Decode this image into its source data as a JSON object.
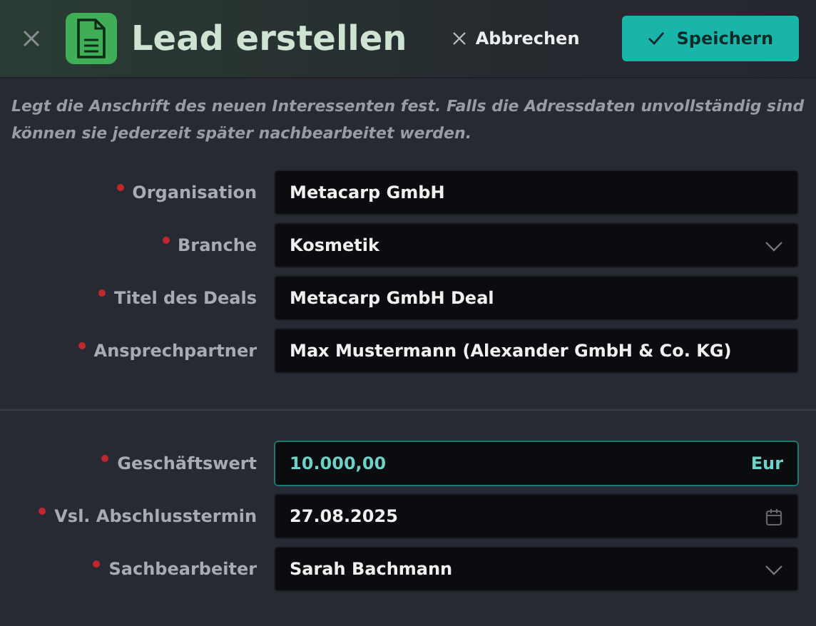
{
  "header": {
    "title": "Lead erstellen",
    "cancel": "Abbrechen",
    "save": "Speichern"
  },
  "description": "Legt die Anschrift des neuen Interessenten fest. Falls die Adressdaten unvollständig sind können sie jederzeit später nachbearbeitet werden.",
  "sections": [
    {
      "fields": [
        {
          "kind": "text",
          "label": "Organisation",
          "required": true,
          "value": "Metacarp GmbH",
          "focused": false
        },
        {
          "kind": "select",
          "label": "Branche",
          "required": true,
          "value": "Kosmetik",
          "focused": false
        },
        {
          "kind": "text",
          "label": "Titel des Deals",
          "required": true,
          "value": "Metacarp GmbH Deal",
          "focused": false
        },
        {
          "kind": "text",
          "label": "Ansprechpartner",
          "required": true,
          "value": "Max Mustermann (Alexander GmbH & Co. KG)",
          "focused": false
        }
      ]
    },
    {
      "fields": [
        {
          "kind": "currency",
          "label": "Geschäftswert",
          "required": true,
          "value": "10.000,00",
          "unit": "Eur",
          "focused": true
        },
        {
          "kind": "date",
          "label": "Vsl. Abschlusstermin",
          "required": true,
          "value": "27.08.2025",
          "focused": false
        },
        {
          "kind": "select",
          "label": "Sachbearbeiter",
          "required": true,
          "value": "Sarah Bachmann",
          "focused": false
        }
      ]
    }
  ]
}
